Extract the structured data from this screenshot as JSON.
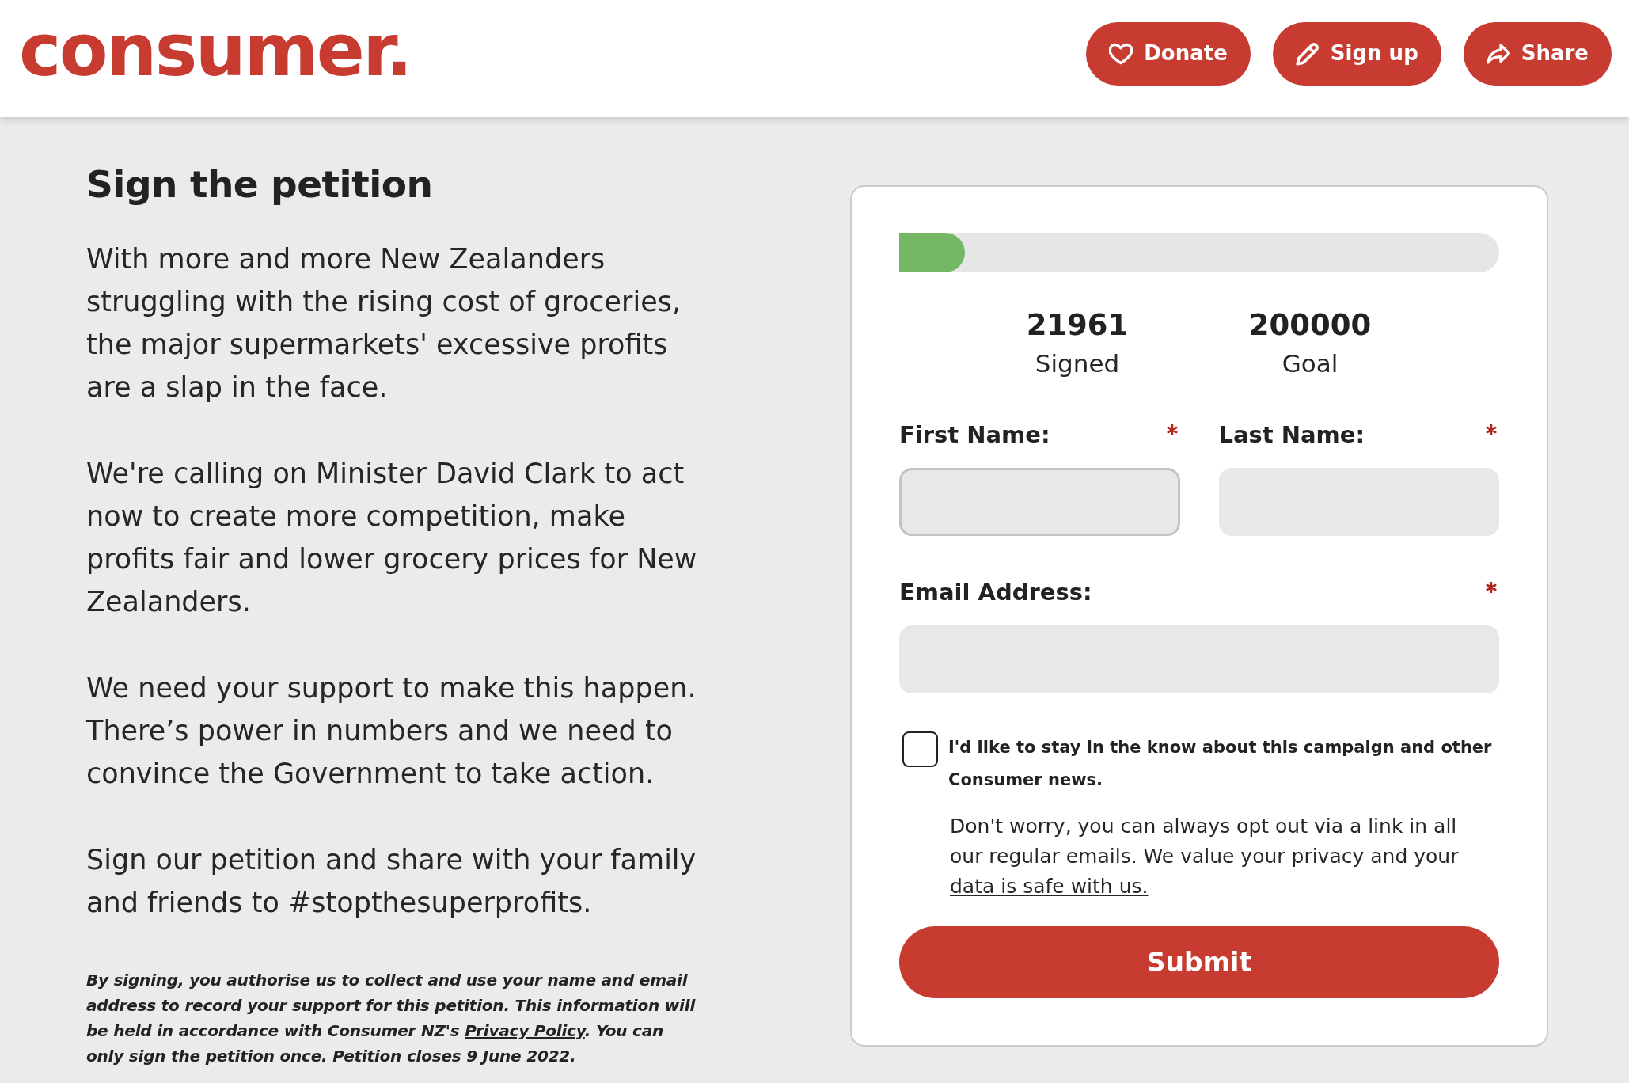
{
  "header": {
    "logo": "consumer.",
    "buttons": [
      {
        "kind": "donate",
        "label": "Donate"
      },
      {
        "kind": "signup",
        "label": "Sign up"
      },
      {
        "kind": "share",
        "label": "Share"
      }
    ]
  },
  "intro": {
    "title": "Sign the petition",
    "paragraphs": [
      "With more and more New Zealanders struggling with the rising cost of groceries, the major supermarkets' excessive profits are a slap in the face.",
      "We're calling on Minister David Clark to act now to create more competition, make profits fair and lower grocery prices for New Zealanders.",
      "We need your support to make this happen. There’s power in numbers and we need to convince the Government to take action.",
      "Sign our petition and share with your family and friends to #stopthesuperprofits."
    ],
    "disclaimer": {
      "text_before": "By signing, you authorise us to collect and use your name and email address to record your support for this petition. This information will be held in accordance with Consumer NZ's ",
      "link": "Privacy Policy",
      "text_after": ". You can only sign the petition once. Petition closes 9 June 2022."
    }
  },
  "petition_form": {
    "progress": {
      "level": 0.11
    },
    "stats": [
      {
        "value": "21961",
        "label": "Signed"
      },
      {
        "value": "200000",
        "label": "Goal"
      }
    ],
    "field_rows": [
      [
        {
          "label": "First Name:",
          "required": true,
          "focused": true
        },
        {
          "label": "Last Name:",
          "required": true,
          "focused": false
        }
      ],
      [
        {
          "label": "Email Address:",
          "required": true,
          "focused": false
        }
      ]
    ],
    "newsletter": {
      "label": "I'd like to stay in the know about this campaign and other Consumer news.",
      "checked": false
    },
    "note": {
      "text": "Don't worry, you can always opt out via a link in all our regular emails. We value your privacy and your ",
      "link": "data is safe with us."
    },
    "submit": "Submit"
  }
}
